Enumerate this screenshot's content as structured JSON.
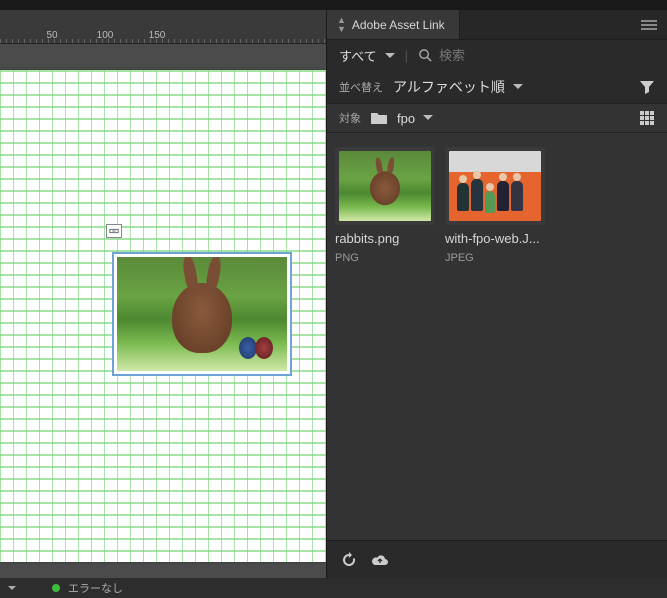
{
  "ruler": {
    "ticks": [
      "50",
      "100",
      "150"
    ],
    "positions": [
      52,
      105,
      157
    ]
  },
  "statusbar": {
    "no_errors_label": "エラーなし"
  },
  "panel": {
    "tab_title": "Adobe Asset Link",
    "filter": {
      "label": "すべて"
    },
    "search": {
      "placeholder": "検索"
    },
    "sort": {
      "label": "並べ替え",
      "value": "アルファベット順"
    },
    "target": {
      "label": "対象",
      "value": "fpo"
    },
    "assets": [
      {
        "name": "rabbits.png",
        "type": "PNG",
        "thumb": "rabbit"
      },
      {
        "name": "with-fpo-web.J...",
        "type": "JPEG",
        "thumb": "people"
      }
    ]
  }
}
